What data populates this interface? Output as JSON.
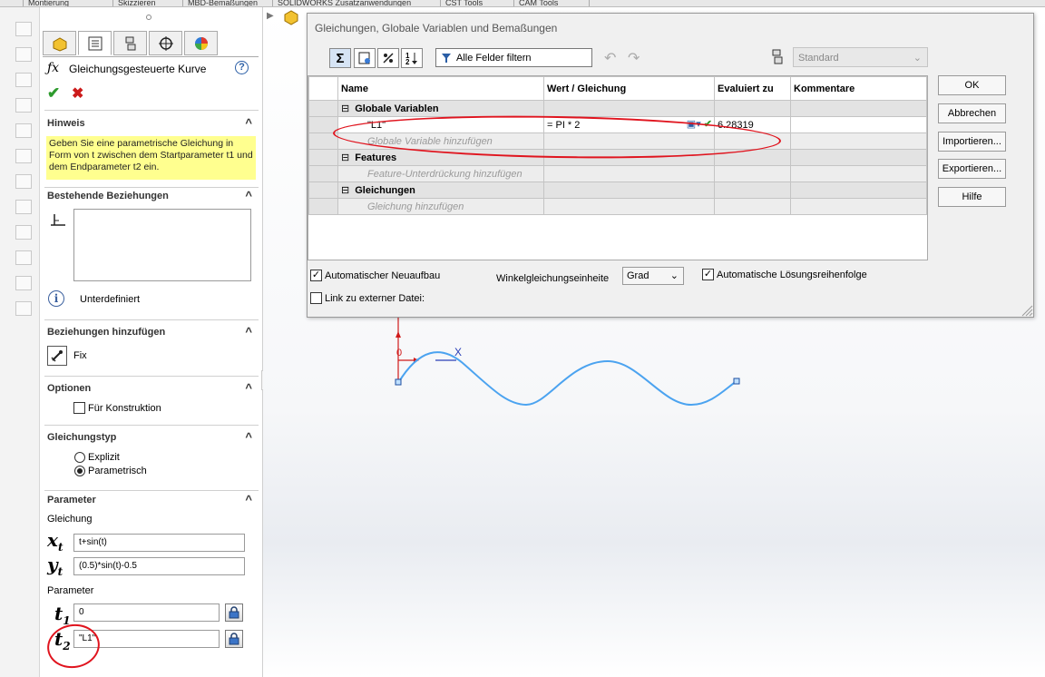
{
  "top_tabs": [
    "Montierung",
    "Skizzieren",
    "MBD-Bemaßungen",
    "SOLIDWORKS Zusatzanwendungen",
    "CST Tools",
    "CAM Tools"
  ],
  "feature_title": "Gleichungsgesteuerte Kurve",
  "hinweis": {
    "title": "Hinweis",
    "text": "Geben Sie eine parametrische Gleichung in Form von t zwischen dem Startparameter t1 und dem Endparameter t2 ein."
  },
  "bestehende": {
    "title": "Bestehende Beziehungen",
    "status": "Unterdefiniert"
  },
  "hinzufuegen": {
    "title": "Beziehungen hinzufügen",
    "fix": "Fix"
  },
  "optionen": {
    "title": "Optionen",
    "konstruktion": "Für Konstruktion"
  },
  "gleichungstyp": {
    "title": "Gleichungstyp",
    "explizit": "Explizit",
    "parametrisch": "Parametrisch",
    "selected": "Parametrisch"
  },
  "parameter": {
    "title": "Parameter",
    "gleichung_label": "Gleichung",
    "xt_value": "t+sin(t)",
    "yt_value": "(0.5)*sin(t)-0.5",
    "parameter_label": "Parameter",
    "t1_value": "0",
    "t2_value": "\"L1\""
  },
  "dialog": {
    "title": "Gleichungen, Globale Variablen und Bemaßungen",
    "filter_label": "Alle Felder filtern",
    "view_select": "Standard",
    "columns": {
      "name": "Name",
      "value": "Wert / Gleichung",
      "evaluated": "Evaluiert zu",
      "comment": "Kommentare"
    },
    "groups": {
      "globals": "Globale Variablen",
      "features": "Features",
      "equations": "Gleichungen"
    },
    "var_name": "\"L1\"",
    "var_value": "= PI * 2",
    "var_evaluated": "6.28319",
    "hints": {
      "globals": "Globale Variable hinzufügen",
      "features": "Feature-Unterdrückung hinzufügen",
      "equations": "Gleichung hinzufügen"
    },
    "buttons": {
      "ok": "OK",
      "cancel": "Abbrechen",
      "import": "Importieren...",
      "export": "Exportieren...",
      "help": "Hilfe"
    },
    "auto_rebuild": "Automatischer Neuaufbau",
    "angle_unit_label": "Winkelgleichungseinheite",
    "angle_unit": "Grad",
    "auto_solve": "Automatische Lösungsreihenfolge",
    "link_external": "Link zu externer Datei:"
  },
  "sketch": {
    "axis_label": "X",
    "origin_label": "0"
  },
  "colors": {
    "curve": "#4ba3f0",
    "highlight": "#e0141e",
    "hint_bg": "#ffff8f"
  }
}
